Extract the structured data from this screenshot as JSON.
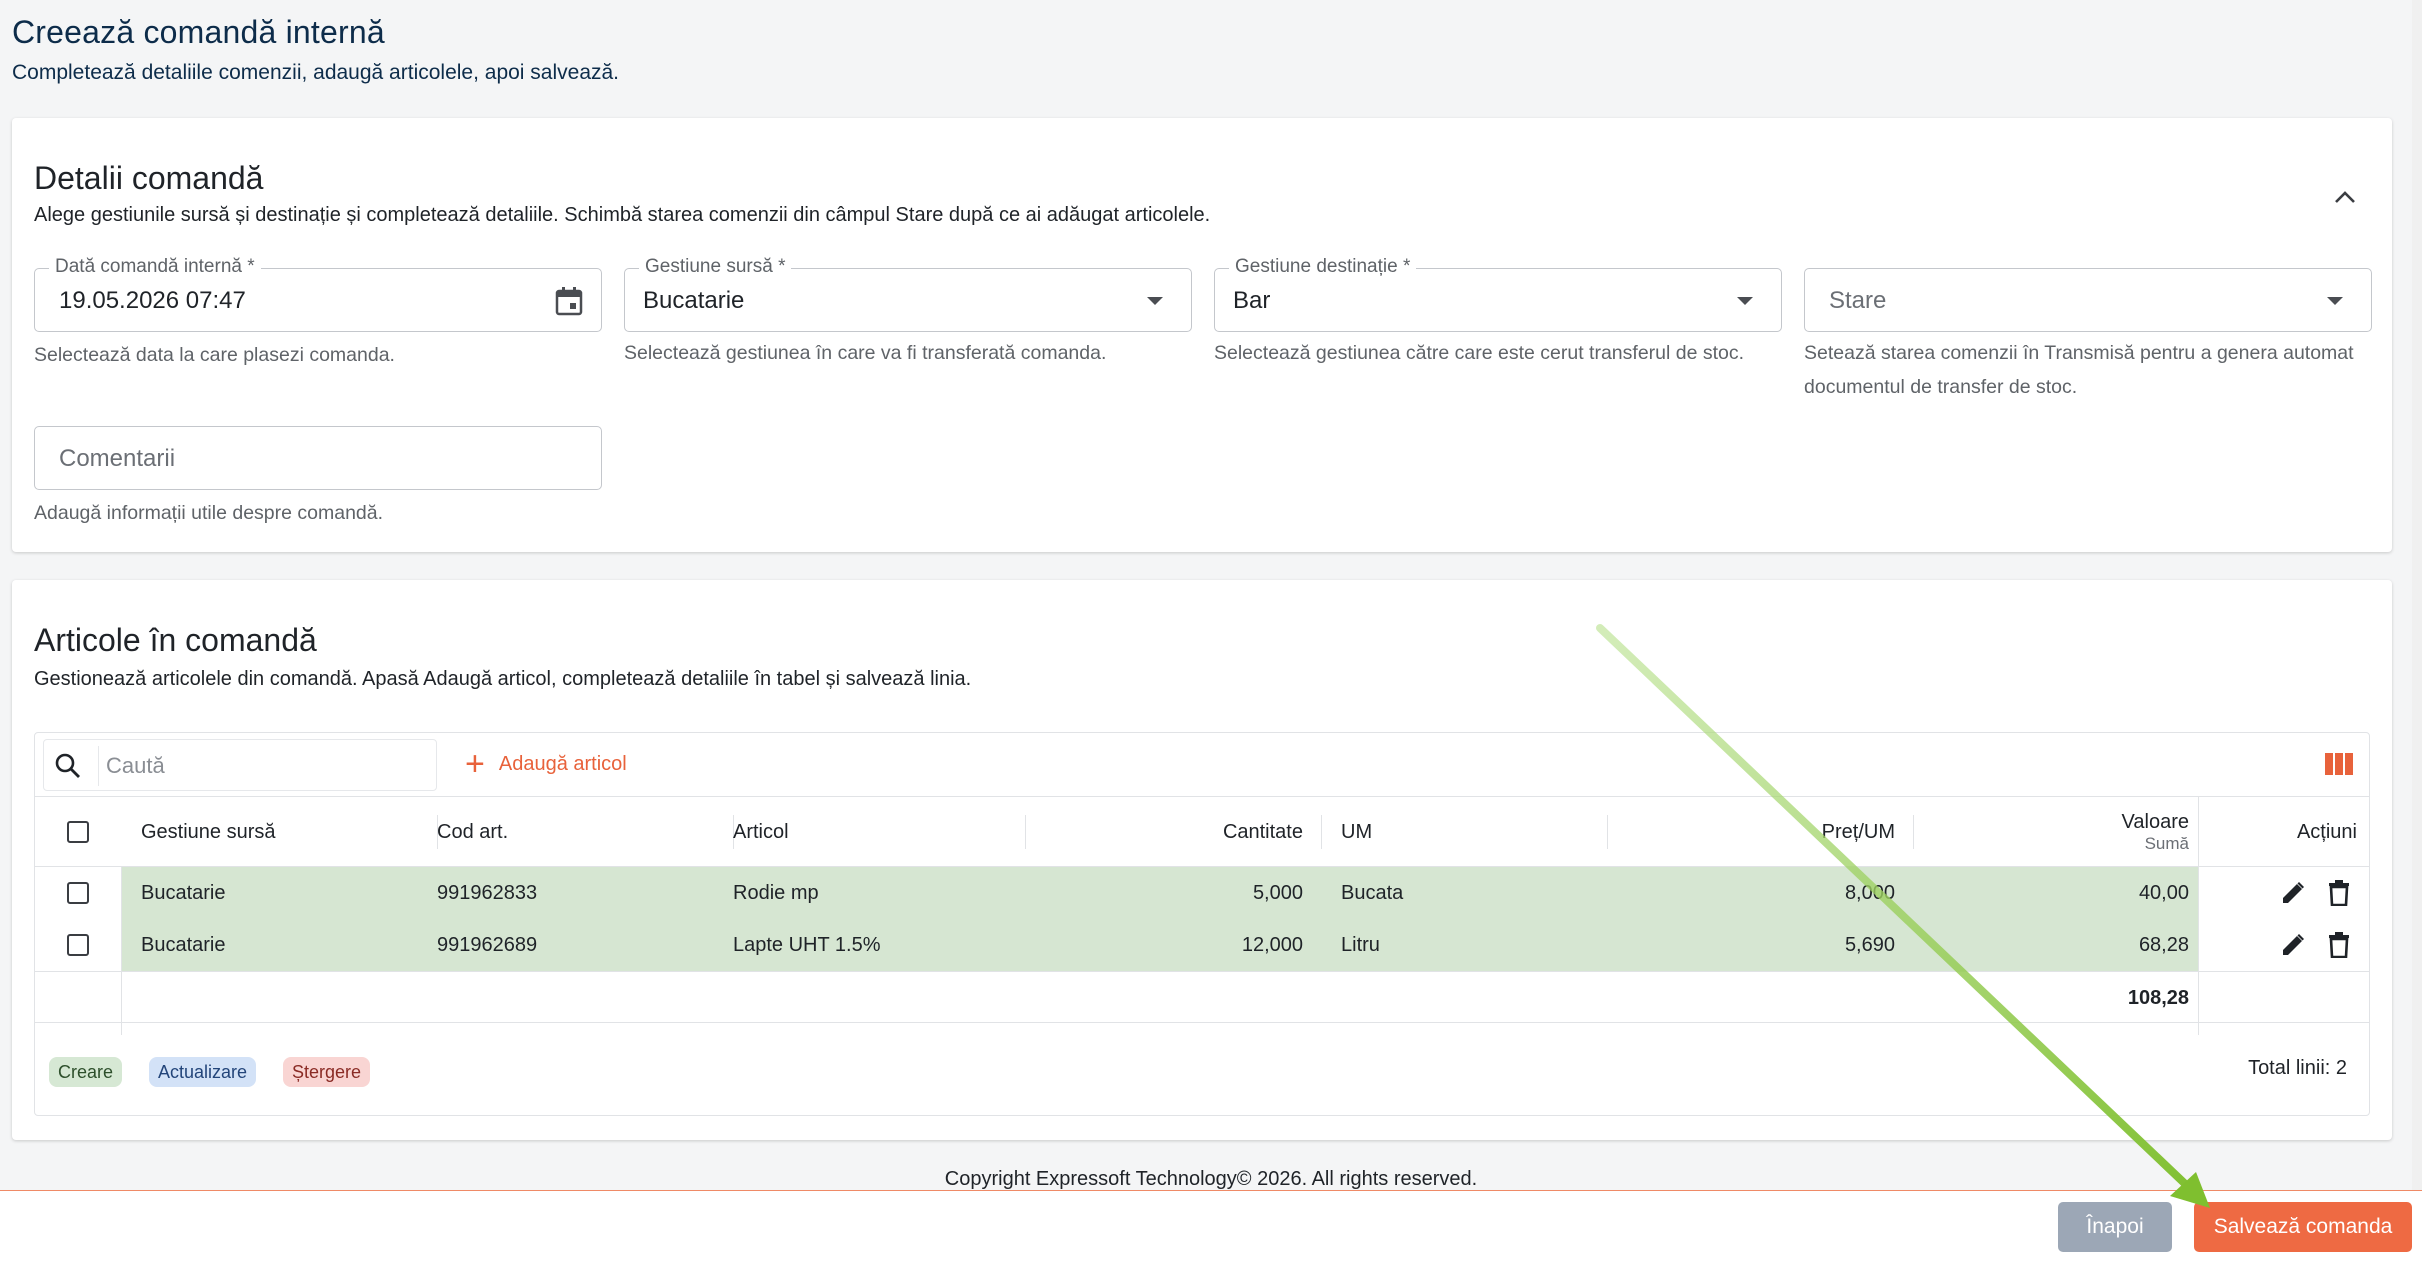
{
  "page": {
    "title": "Creează comandă internă",
    "subtitle": "Completează detaliile comenzii, adaugă articolele, apoi salvează."
  },
  "details": {
    "title": "Detalii comandă",
    "description": "Alege gestiunile sursă și destinație și completează detaliile. Schimbă starea comenzii din câmpul Stare după ce ai adăugat articolele.",
    "date_field": {
      "label": "Dată comandă internă *",
      "value": "19.05.2026 07:47",
      "helper": "Selectează data la care plasezi comanda."
    },
    "source_field": {
      "label": "Gestiune sursă *",
      "value": "Bucatarie",
      "helper": "Selectează gestiunea în care va fi transferată comanda."
    },
    "destination_field": {
      "label": "Gestiune destinație *",
      "value": "Bar",
      "helper": "Selectează gestiunea către care este cerut transferul de stoc."
    },
    "status_field": {
      "placeholder": "Stare",
      "helper": "Setează starea comenzii în Transmisă pentru a genera automat documentul de transfer de stoc."
    },
    "comments_field": {
      "placeholder": "Comentarii",
      "helper": "Adaugă informații utile despre comandă."
    }
  },
  "articles": {
    "title": "Articole în comandă",
    "description": "Gestionează articolele din comandă. Apasă Adaugă articol, completează detaliile în tabel și salvează linia.",
    "search_placeholder": "Caută",
    "add_label": "Adaugă articol",
    "columns": {
      "source": "Gestiune sursă",
      "code": "Cod art.",
      "article": "Articol",
      "quantity": "Cantitate",
      "unit": "UM",
      "price": "Preț/UM",
      "value": "Valoare",
      "value_sub": "Sumă",
      "actions": "Acțiuni"
    },
    "rows": [
      {
        "source": "Bucatarie",
        "code": "991962833",
        "article": "Rodie mp",
        "quantity": "5,000",
        "unit": "Bucata",
        "price": "8,000",
        "value": "40,00"
      },
      {
        "source": "Bucatarie",
        "code": "991962689",
        "article": "Lapte UHT 1.5%",
        "quantity": "12,000",
        "unit": "Litru",
        "price": "5,690",
        "value": "68,28"
      }
    ],
    "total": "108,28",
    "legend": {
      "create": "Creare",
      "update": "Actualizare",
      "delete": "Ștergere"
    },
    "total_lines": "Total linii: 2"
  },
  "footer": {
    "copyright": "Copyright Expressoft Technology© 2026. All rights reserved.",
    "back_label": "Înapoi",
    "save_label": "Salvează comanda"
  },
  "colors": {
    "accent": "#ee6a43",
    "row_highlight": "#d6e6d2",
    "title_blue": "#0d2c4a",
    "arrow": "#8cc63f"
  },
  "icons": [
    "calendar-icon",
    "chevron-up-icon",
    "search-icon",
    "plus-icon",
    "columns-icon",
    "edit-icon",
    "trash-icon"
  ]
}
